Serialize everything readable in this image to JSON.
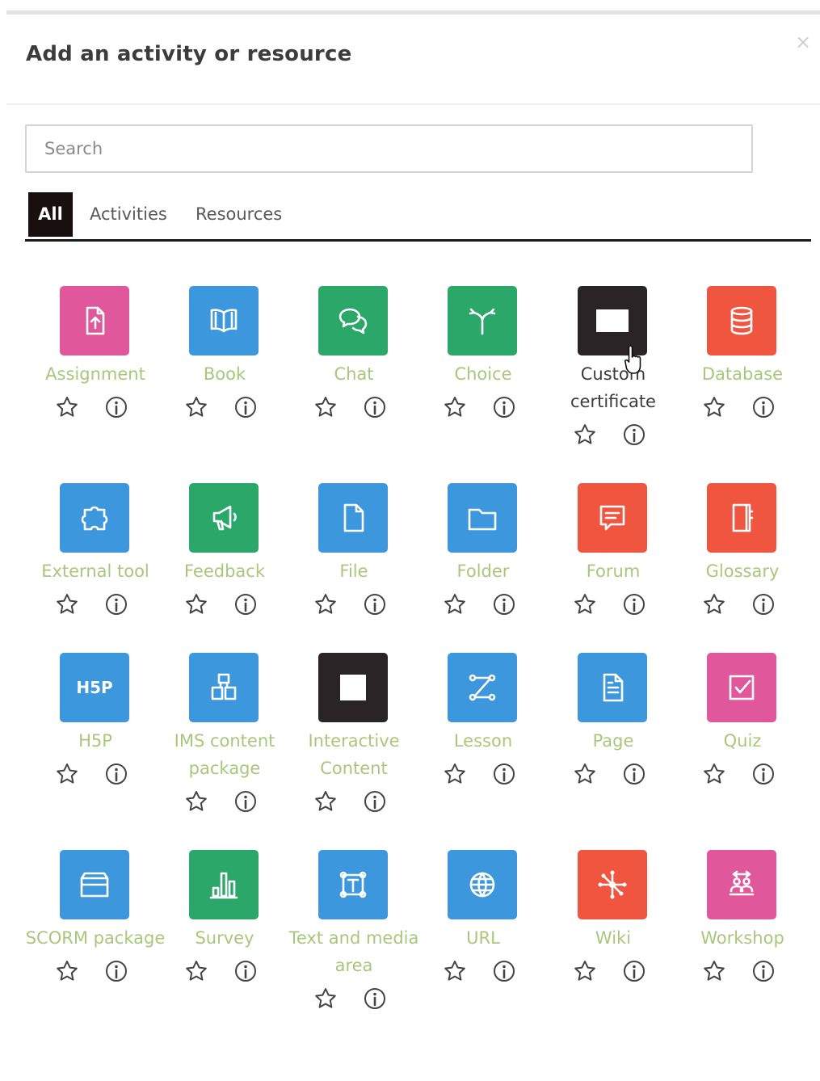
{
  "modal": {
    "title": "Add an activity or resource",
    "close_symbol": "×"
  },
  "search": {
    "placeholder": "Search"
  },
  "tabs": [
    {
      "label": "All",
      "active": true
    },
    {
      "label": "Activities",
      "active": false
    },
    {
      "label": "Resources",
      "active": false
    }
  ],
  "colors": {
    "pink": "#e1579c",
    "blue": "#3d97dd",
    "green": "#2ca76a",
    "dark": "#2a2426",
    "orange": "#f0563f",
    "label_green": "#a9c77c",
    "tab_active_bg": "#1a0f0f"
  },
  "items": [
    {
      "label": "Assignment",
      "icon": "assignment-icon",
      "color": "#e1579c"
    },
    {
      "label": "Book",
      "icon": "book-icon",
      "color": "#3d97dd"
    },
    {
      "label": "Chat",
      "icon": "chat-icon",
      "color": "#2ca76a"
    },
    {
      "label": "Choice",
      "icon": "choice-icon",
      "color": "#2ca76a"
    },
    {
      "label": "Custom certificate",
      "icon": "certificate-icon",
      "color": "#2a2426",
      "hovered": true
    },
    {
      "label": "Database",
      "icon": "database-icon",
      "color": "#f0563f"
    },
    {
      "label": "External tool",
      "icon": "external-tool-icon",
      "color": "#3d97dd"
    },
    {
      "label": "Feedback",
      "icon": "feedback-icon",
      "color": "#2ca76a"
    },
    {
      "label": "File",
      "icon": "file-icon",
      "color": "#3d97dd"
    },
    {
      "label": "Folder",
      "icon": "folder-icon",
      "color": "#3d97dd"
    },
    {
      "label": "Forum",
      "icon": "forum-icon",
      "color": "#f0563f"
    },
    {
      "label": "Glossary",
      "icon": "glossary-icon",
      "color": "#f0563f"
    },
    {
      "label": "H5P",
      "icon": "h5p-icon",
      "color": "#3d97dd"
    },
    {
      "label": "IMS content package",
      "icon": "ims-package-icon",
      "color": "#3d97dd"
    },
    {
      "label": "Interactive Content",
      "icon": "interactive-content-icon",
      "color": "#2a2426"
    },
    {
      "label": "Lesson",
      "icon": "lesson-icon",
      "color": "#3d97dd"
    },
    {
      "label": "Page",
      "icon": "page-icon",
      "color": "#3d97dd"
    },
    {
      "label": "Quiz",
      "icon": "quiz-icon",
      "color": "#e1579c"
    },
    {
      "label": "SCORM package",
      "icon": "scorm-package-icon",
      "color": "#3d97dd"
    },
    {
      "label": "Survey",
      "icon": "survey-icon",
      "color": "#2ca76a"
    },
    {
      "label": "Text and media area",
      "icon": "text-media-icon",
      "color": "#3d97dd"
    },
    {
      "label": "URL",
      "icon": "url-icon",
      "color": "#3d97dd"
    },
    {
      "label": "Wiki",
      "icon": "wiki-icon",
      "color": "#f0563f"
    },
    {
      "label": "Workshop",
      "icon": "workshop-icon",
      "color": "#e1579c"
    }
  ]
}
